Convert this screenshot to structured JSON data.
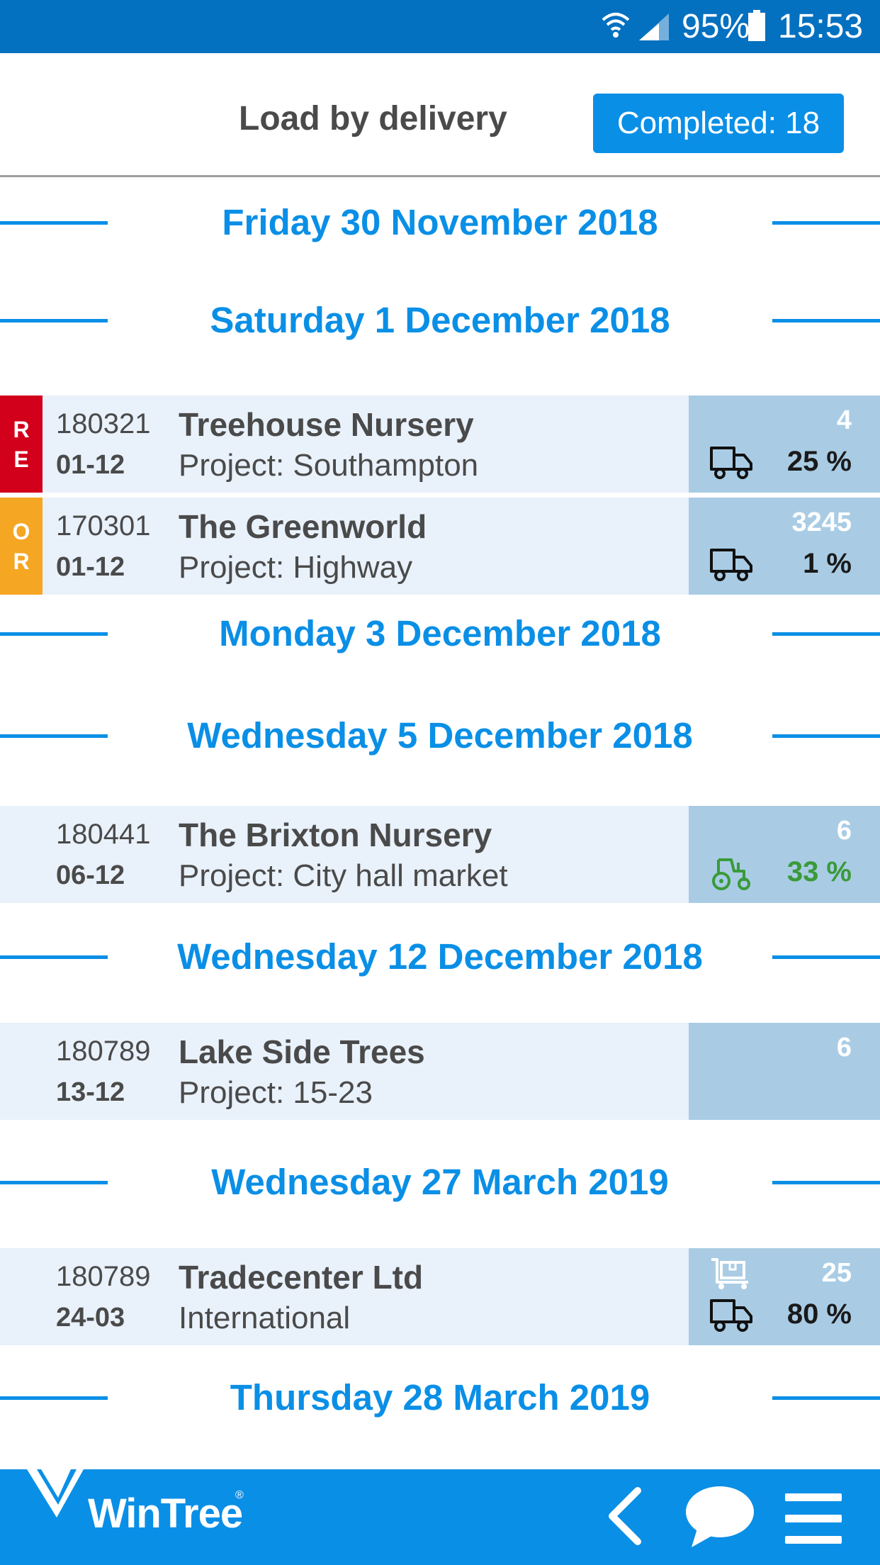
{
  "status": {
    "battery": "95%",
    "time": "15:53"
  },
  "header": {
    "title": "Load by delivery",
    "completed": "Completed: 18"
  },
  "dates": [
    "Friday 30 November 2018",
    "Saturday 1 December 2018",
    "Monday 3 December 2018",
    "Wednesday 5 December 2018",
    "Wednesday 12 December 2018",
    "Wednesday 27 March 2019",
    "Thursday 28 March 2019"
  ],
  "rows": [
    {
      "tag": [
        "R",
        "E"
      ],
      "tag_color": "#d3001b",
      "order": "180321",
      "date": "01-12",
      "customer": "Treehouse Nursery",
      "project": "Project: Southampton",
      "count": "4",
      "vehicle": "truck-icon",
      "percent": "25 %"
    },
    {
      "tag": [
        "O",
        "R"
      ],
      "tag_color": "#f5a623",
      "order": "170301",
      "date": "01-12",
      "customer": "The Greenworld",
      "project": "Project: Highway",
      "count": "3245",
      "vehicle": "truck-icon",
      "percent": "1 %"
    },
    {
      "order": "180441",
      "date": "06-12",
      "customer": "The Brixton Nursery",
      "project": "Project: City hall market",
      "count": "6",
      "vehicle": "tractor-icon",
      "percent": "33 %"
    },
    {
      "order": "180789",
      "date": "13-12",
      "customer": "Lake Side Trees",
      "project": "Project: 15-23",
      "count": "6"
    },
    {
      "order": "180789",
      "date": "24-03",
      "customer": "Tradecenter Ltd",
      "project": "International",
      "count": "25",
      "vehicle": "truck-icon",
      "percent": "80 %",
      "extra_icon": "cart-icon"
    }
  ],
  "footer": {
    "brand": "WinTree",
    "registered": "®"
  },
  "colors": {
    "primary": "#0a8fe6",
    "status_bar": "#0470c0",
    "row_bg": "#e9f1fb",
    "side_bg": "#a9cce4",
    "green": "#3a9a3a"
  }
}
